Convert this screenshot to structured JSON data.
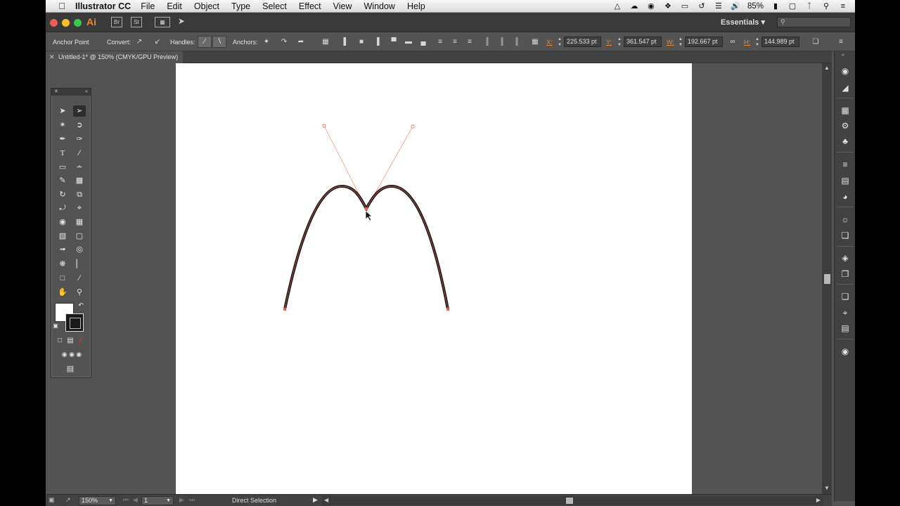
{
  "menubar": {
    "apple": "",
    "app_name": "Illustrator CC",
    "items": [
      "File",
      "Edit",
      "Object",
      "Type",
      "Select",
      "Effect",
      "View",
      "Window",
      "Help"
    ],
    "battery": "85%"
  },
  "appbar": {
    "logo": "Ai",
    "bridge": "Br",
    "stock": "St",
    "workspace": "Essentials",
    "search_placeholder": ""
  },
  "controlbar": {
    "tool_name": "Anchor Point",
    "convert_label": "Convert:",
    "handles_label": "Handles:",
    "anchors_label": "Anchors:",
    "x_label": "X:",
    "x_value": "225.533 pt",
    "y_label": "Y:",
    "y_value": "361.547 pt",
    "w_label": "W:",
    "w_value": "192.667 pt",
    "h_label": "H:",
    "h_value": "144.989 pt"
  },
  "document": {
    "tab_title": "Untitled-1* @ 150% (CMYK/GPU Preview)"
  },
  "statusbar": {
    "zoom": "150%",
    "artboard_number": "1",
    "status_text": "Direct Selection"
  },
  "colors": {
    "accent": "#e08b3a",
    "path_stroke": "#1a1a1a",
    "anchor_highlight": "#e8604c",
    "handle_line": "#e8a080"
  },
  "icons": {
    "tools": [
      "selection-tool",
      "direct-selection-tool",
      "magic-wand-tool",
      "lasso-tool",
      "pen-tool",
      "curvature-tool",
      "type-tool",
      "line-segment-tool",
      "rectangle-tool",
      "paintbrush-tool",
      "pencil-tool",
      "eraser-tool",
      "rotate-tool",
      "scale-tool",
      "width-tool",
      "free-transform-tool",
      "shape-builder-tool",
      "perspective-grid-tool",
      "mesh-tool",
      "gradient-tool",
      "eyedropper-tool",
      "blend-tool",
      "symbol-sprayer-tool",
      "column-graph-tool",
      "artboard-tool",
      "slice-tool",
      "hand-tool",
      "zoom-tool"
    ]
  }
}
